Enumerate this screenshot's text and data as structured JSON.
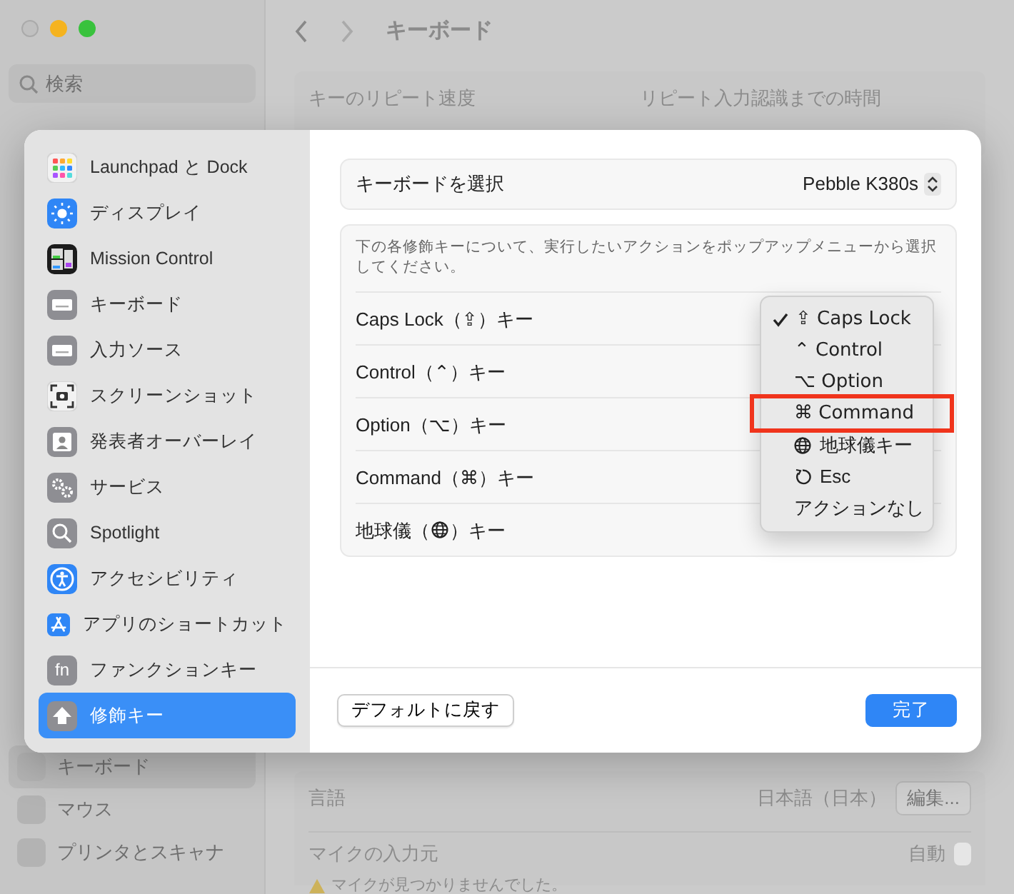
{
  "window": {
    "title": "キーボード",
    "search": {
      "placeholder": "検索"
    }
  },
  "background_sidebar": [
    {
      "label": "キーボード",
      "selected": true
    },
    {
      "label": "マウス",
      "selected": false
    },
    {
      "label": "プリンタとスキャナ",
      "selected": false
    }
  ],
  "background_settings": {
    "top": [
      "キーのリピート速度",
      "リピート入力認識までの時間"
    ],
    "language": {
      "label": "言語",
      "value": "日本語（日本）",
      "button": "編集..."
    },
    "mic": {
      "label": "マイクの入力元",
      "value": "自動",
      "warning": "マイクが見つかりませんでした。"
    }
  },
  "sheet": {
    "sidebar": [
      {
        "label": "Launchpad と Dock",
        "kind": "launchpad",
        "color": "#f2f2f2",
        "selected": false
      },
      {
        "label": "ディスプレイ",
        "kind": "sun",
        "color": "#2f86f6",
        "selected": false
      },
      {
        "label": "Mission Control",
        "kind": "windows",
        "color": "#1c1c1c",
        "selected": false
      },
      {
        "label": "キーボード",
        "kind": "keyboard",
        "color": "#8e8e93",
        "selected": false
      },
      {
        "label": "入力ソース",
        "kind": "keyboard",
        "color": "#8e8e93",
        "selected": false
      },
      {
        "label": "スクリーンショット",
        "kind": "screenshot",
        "color": "#f2f2f2",
        "selected": false
      },
      {
        "label": "発表者オーバーレイ",
        "kind": "person",
        "color": "#8e8e93",
        "selected": false
      },
      {
        "label": "サービス",
        "kind": "gears",
        "color": "#8e8e93",
        "selected": false
      },
      {
        "label": "Spotlight",
        "kind": "search",
        "color": "#8e8e93",
        "selected": false
      },
      {
        "label": "アクセシビリティ",
        "kind": "accessibility",
        "color": "#2f86f6",
        "selected": false
      },
      {
        "label": "アプリのショートカット",
        "kind": "appstore",
        "color": "#2f86f6",
        "selected": false
      },
      {
        "label": "ファンクションキー",
        "kind": "glyph",
        "glyph": "fn",
        "color": "#8e8e93",
        "selected": false
      },
      {
        "label": "修飾キー",
        "kind": "arrow",
        "color": "#8e8e93",
        "selected": true
      }
    ],
    "keyboard_select": {
      "label": "キーボードを選択",
      "value": "Pebble K380s"
    },
    "description": "下の各修飾キーについて、実行したいアクションをポップアップメニューから選択してください。",
    "modifier_rows": [
      {
        "kind": "text",
        "label": "Caps Lock（⇪）キー"
      },
      {
        "kind": "text",
        "label": "Control（⌃）キー"
      },
      {
        "kind": "text",
        "label": "Option（⌥）キー"
      },
      {
        "kind": "text",
        "label": "Command（⌘）キー"
      },
      {
        "kind": "globe",
        "label": "地球儀（",
        "label_end": "）キー"
      }
    ],
    "buttons": {
      "reset": "デフォルトに戻す",
      "done": "完了"
    }
  },
  "popup_menu": {
    "items": [
      {
        "kind": "symbol",
        "symbol": "⇪",
        "label": "Caps Lock",
        "checked": true,
        "annotated": false
      },
      {
        "kind": "symbol",
        "symbol": "⌃",
        "label": "Control",
        "checked": false,
        "annotated": false
      },
      {
        "kind": "symbol",
        "symbol": "⌥",
        "label": "Option",
        "checked": false,
        "annotated": false
      },
      {
        "kind": "symbol",
        "symbol": "⌘",
        "label": "Command",
        "checked": false,
        "annotated": true
      },
      {
        "kind": "globe",
        "label": "地球儀キー",
        "checked": false,
        "annotated": false
      },
      {
        "kind": "restart",
        "label": "Esc",
        "checked": false,
        "annotated": false
      },
      {
        "kind": "plain",
        "label": "アクションなし",
        "checked": false,
        "annotated": false
      }
    ]
  }
}
